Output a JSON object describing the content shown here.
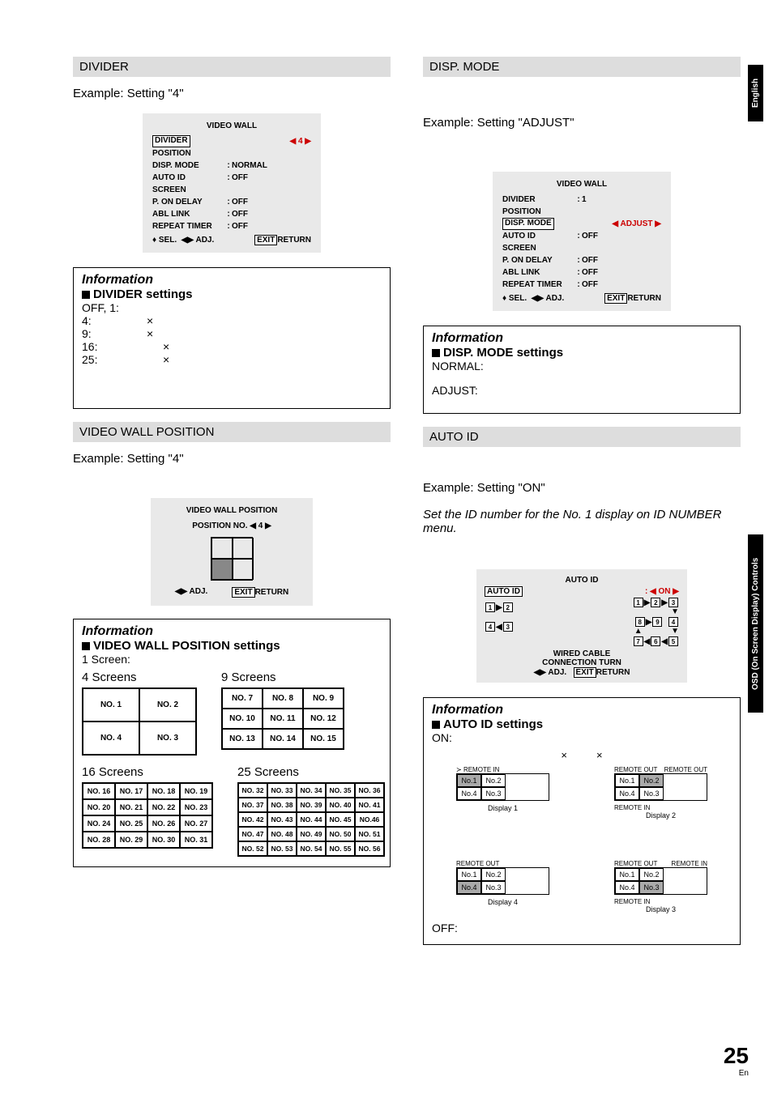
{
  "sideTabs": {
    "english": "English",
    "osd": "OSD (On Screen Display) Controls"
  },
  "pageNum": "25",
  "pageLang": "En",
  "left": {
    "divider": {
      "heading": "DIVIDER",
      "example": "Example: Setting \"4\"",
      "osd": {
        "title": "VIDEO WALL",
        "rows": [
          {
            "label": "DIVIDER",
            "sel": true,
            "value": "◀ 4 ▶"
          },
          {
            "label": "POSITION",
            "value": ""
          },
          {
            "label": "DISP. MODE",
            "value": "NORMAL"
          },
          {
            "label": "AUTO ID",
            "value": "OFF"
          },
          {
            "label": "SCREEN",
            "value": ""
          },
          {
            "label": "P. ON DELAY",
            "value": "OFF"
          },
          {
            "label": "ABL LINK",
            "value": "OFF"
          },
          {
            "label": "REPEAT TIMER",
            "value": "OFF"
          }
        ],
        "footer": {
          "sel": "SEL.",
          "adj": "ADJ.",
          "exit": "EXIT",
          "ret": "RETURN"
        }
      },
      "info": {
        "title": "Information",
        "sub": "DIVIDER settings",
        "lines": [
          {
            "k": "OFF, 1:",
            "x": ""
          },
          {
            "k": "4:",
            "x": "×"
          },
          {
            "k": "9:",
            "x": "×"
          },
          {
            "k": "16:",
            "x": "×"
          },
          {
            "k": "25:",
            "x": "×"
          }
        ]
      }
    },
    "position": {
      "heading": "VIDEO WALL POSITION",
      "example": "Example: Setting \"4\"",
      "osd": {
        "title": "VIDEO WALL POSITION",
        "posLabel": "POSITION NO. ◀ 4 ▶",
        "footer": {
          "adj": "ADJ.",
          "exit": "EXIT",
          "ret": "RETURN"
        }
      },
      "info": {
        "title": "Information",
        "sub": "VIDEO WALL POSITION settings",
        "oneScreen": "1 Screen:",
        "grids": {
          "s4": {
            "h": "4 Screens",
            "cells": [
              "NO. 1",
              "NO. 2",
              "NO. 4",
              "NO. 3"
            ]
          },
          "s9": {
            "h": "9 Screens",
            "cells": [
              "NO. 7",
              "NO. 8",
              "NO. 9",
              "NO. 10",
              "NO. 11",
              "NO. 12",
              "NO. 13",
              "NO. 14",
              "NO. 15"
            ]
          },
          "s16": {
            "h": "16 Screens",
            "cells": [
              "NO. 16",
              "NO. 17",
              "NO. 18",
              "NO. 19",
              "NO. 20",
              "NO. 21",
              "NO. 22",
              "NO. 23",
              "NO. 24",
              "NO. 25",
              "NO. 26",
              "NO. 27",
              "NO. 28",
              "NO. 29",
              "NO. 30",
              "NO. 31"
            ]
          },
          "s25": {
            "h": "25 Screens",
            "cells": [
              "NO. 32",
              "NO. 33",
              "NO. 34",
              "NO. 35",
              "NO. 36",
              "NO. 37",
              "NO. 38",
              "NO. 39",
              "NO. 40",
              "NO. 41",
              "NO. 42",
              "NO. 43",
              "NO. 44",
              "NO. 45",
              "NO.46",
              "NO. 47",
              "NO. 48",
              "NO. 49",
              "NO. 50",
              "NO. 51",
              "NO. 52",
              "NO. 53",
              "NO. 54",
              "NO. 55",
              "NO. 56"
            ]
          }
        }
      }
    }
  },
  "right": {
    "dispMode": {
      "heading": "DISP. MODE",
      "example": "Example: Setting \"ADJUST\"",
      "osd": {
        "title": "VIDEO WALL",
        "rows": [
          {
            "label": "DIVIDER",
            "value": "1"
          },
          {
            "label": "POSITION",
            "value": ""
          },
          {
            "label": "DISP. MODE",
            "sel": true,
            "value": "◀ ADJUST ▶"
          },
          {
            "label": "AUTO ID",
            "value": "OFF"
          },
          {
            "label": "SCREEN",
            "value": ""
          },
          {
            "label": "P. ON DELAY",
            "value": "OFF"
          },
          {
            "label": "ABL LINK",
            "value": "OFF"
          },
          {
            "label": "REPEAT TIMER",
            "value": "OFF"
          }
        ],
        "footer": {
          "sel": "SEL.",
          "adj": "ADJ.",
          "exit": "EXIT",
          "ret": "RETURN"
        }
      },
      "info": {
        "title": "Information",
        "sub": "DISP. MODE settings",
        "normal": "NORMAL:",
        "adjust": "ADJUST:"
      }
    },
    "autoId": {
      "heading": "AUTO ID",
      "example": "Example: Setting \"ON\"",
      "note": "Set the ID number for the No. 1 display on ID NUMBER menu.",
      "osd": {
        "title": "AUTO ID",
        "selLabel": "AUTO ID",
        "selValue": ": ◀ ON ▶",
        "left2x2": {
          "seq1": [
            "1",
            "2"
          ],
          "seq2": [
            "4",
            "3"
          ]
        },
        "right3x3": {
          "r1": [
            "1",
            "2",
            "3"
          ],
          "r2": [
            "8",
            "9",
            "4"
          ],
          "r3": [
            "7",
            "6",
            "5"
          ]
        },
        "wired": "WIRED CABLE",
        "conn": "CONNECTION TURN",
        "footer": {
          "adj": "ADJ.",
          "exit": "EXIT",
          "ret": "RETURN"
        }
      },
      "info": {
        "title": "Information",
        "sub": "AUTO ID settings",
        "on": "ON:",
        "off": "OFF:",
        "diagLabels": {
          "remoteIn": "REMOTE IN",
          "remoteOut": "REMOTE OUT",
          "d1": "Display 1",
          "d2": "Display 2",
          "d3": "Display 3",
          "d4": "Display 4",
          "cells": [
            "No.1",
            "No.2",
            "No.4",
            "No.3"
          ]
        }
      }
    }
  }
}
